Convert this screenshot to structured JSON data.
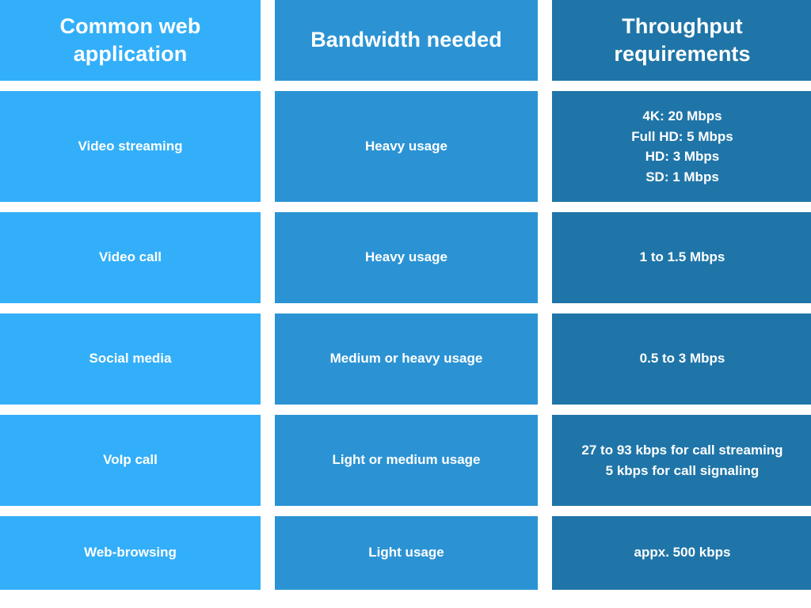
{
  "table": {
    "headers": [
      {
        "label": "Common web application",
        "lines": [
          "Common web",
          "application"
        ]
      },
      {
        "label": "Bandwidth needed",
        "lines": [
          "Bandwidth needed"
        ]
      },
      {
        "label": "Throughput requirements",
        "lines": [
          "Throughput",
          "requirements"
        ]
      }
    ],
    "rows": [
      {
        "application": "Video streaming",
        "bandwidth": "Heavy usage",
        "throughput": "4K: 20 Mbps Full HD: 5 Mbps HD: 3 Mbps SD: 1 Mbps",
        "throughput_lines": [
          "4K: 20 Mbps",
          "Full HD: 5 Mbps",
          "HD: 3 Mbps",
          "SD: 1 Mbps"
        ]
      },
      {
        "application": "Video call",
        "bandwidth": "Heavy usage",
        "throughput": "1 to 1.5 Mbps",
        "throughput_lines": [
          "1 to 1.5 Mbps"
        ]
      },
      {
        "application": "Social media",
        "bandwidth": "Medium or heavy usage",
        "throughput": "0.5 to 3 Mbps",
        "throughput_lines": [
          "0.5 to 3 Mbps"
        ]
      },
      {
        "application": "VoIp call",
        "bandwidth": "Light or medium usage",
        "throughput": "27 to 93 kbps for call streaming 5 kbps for call signaling",
        "throughput_lines": [
          "27 to 93 kbps for call streaming",
          "5 kbps for call signaling"
        ]
      },
      {
        "application": "Web-browsing",
        "bandwidth": "Light usage",
        "throughput": "appx. 500 kbps",
        "throughput_lines": [
          "appx. 500 kbps"
        ]
      }
    ]
  },
  "colors": {
    "column_1": "#33aff9",
    "column_2": "#2b93d4",
    "column_3": "#1f75a8",
    "background": "#ffffff",
    "text": "#ffffff"
  }
}
